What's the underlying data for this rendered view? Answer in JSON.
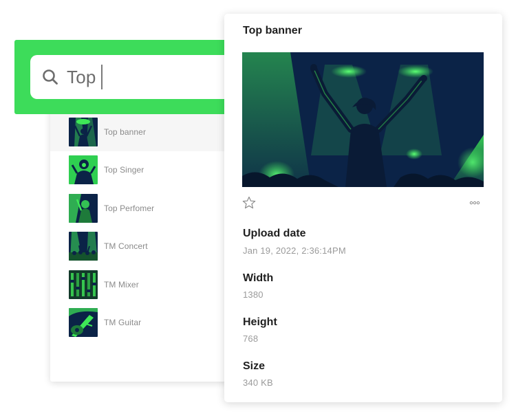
{
  "search": {
    "value": "Top"
  },
  "results": [
    {
      "label": "Top banner",
      "selected": true
    },
    {
      "label": "Top Singer",
      "selected": false
    },
    {
      "label": "Top Perfomer",
      "selected": false
    },
    {
      "label": "TM Concert",
      "selected": false
    },
    {
      "label": "TM Mixer",
      "selected": false
    },
    {
      "label": "TM Guitar",
      "selected": false
    }
  ],
  "detail": {
    "title": "Top banner",
    "upload_date_label": "Upload date",
    "upload_date_value": "Jan 19, 2022, 2:36:14PM",
    "width_label": "Width",
    "width_value": "1380",
    "height_label": "Height",
    "height_value": "768",
    "size_label": "Size",
    "size_value": "340 KB"
  },
  "icons": {
    "search": "search-icon",
    "favorite": "star-icon",
    "more": "more-options-icon"
  },
  "colors": {
    "accent_green": "#3ddc5a",
    "image_dark": "#0b2347",
    "image_light": "#3ee857"
  }
}
